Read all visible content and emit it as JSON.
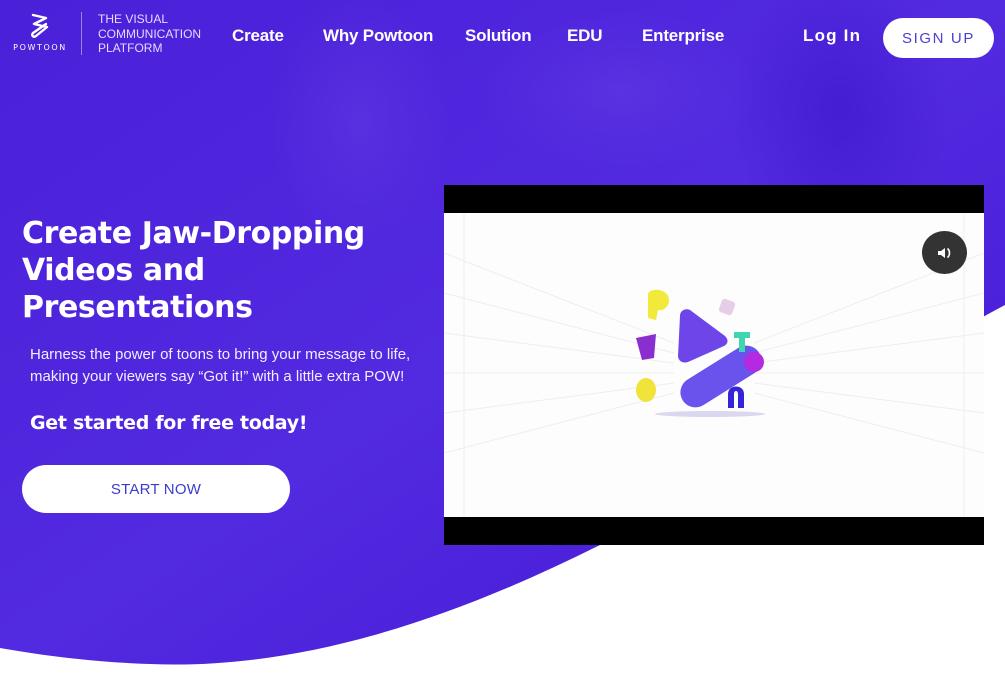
{
  "brand": {
    "name": "POWTOON",
    "tagline": [
      "THE VISUAL",
      "COMMUNICATION",
      "PLATFORM"
    ],
    "primary_color": "#4b22db",
    "accent_text_color": "#4b3fd4"
  },
  "nav": {
    "items": [
      {
        "label": "Create"
      },
      {
        "label": "Why Powtoon"
      },
      {
        "label": "Solution"
      },
      {
        "label": "EDU"
      },
      {
        "label": "Enterprise"
      }
    ],
    "login_label": "Log In",
    "signup_label": "SIGN UP"
  },
  "hero": {
    "headline": [
      "Create Jaw-Dropping",
      "Videos and Presentations"
    ],
    "description": "Harness the power of toons to bring your message to life, making your viewers say “Got it!” with a little extra POW!",
    "subheadline": "Get started for free today!",
    "cta_label": "START NOW"
  },
  "video": {
    "mute_icon": "speaker-volume-icon"
  }
}
